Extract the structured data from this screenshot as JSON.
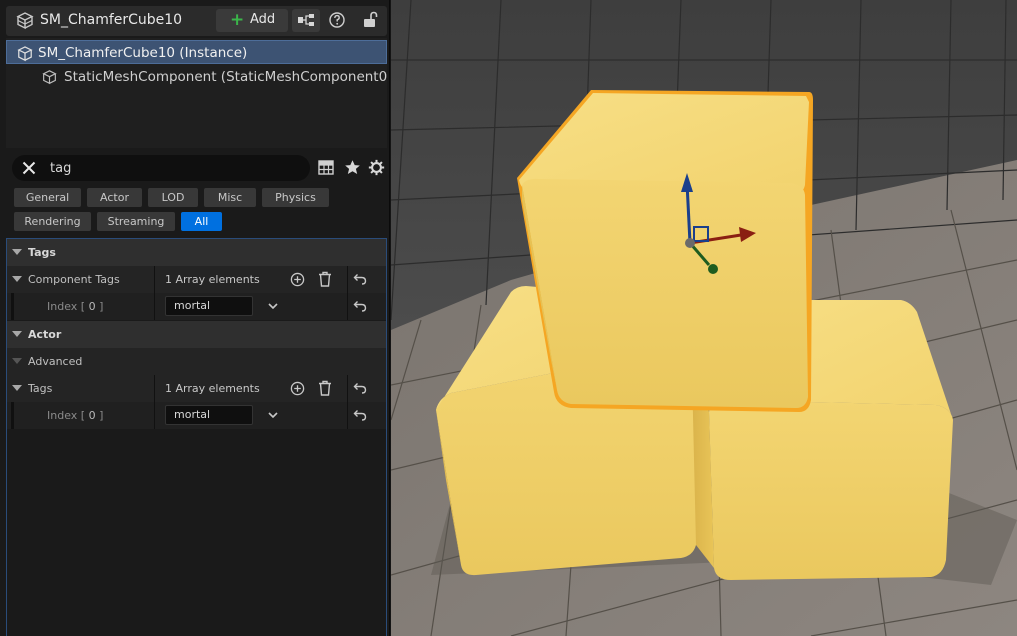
{
  "header": {
    "actor_name": "SM_ChamferCube10",
    "add_label": "Add"
  },
  "tree": {
    "items": [
      {
        "label": "SM_ChamferCube10 (Instance)",
        "selected": true
      },
      {
        "label": "StaticMeshComponent (StaticMeshComponent0)",
        "selected": false
      }
    ]
  },
  "search": {
    "value": "tag"
  },
  "filters": {
    "row1": [
      "General",
      "Actor",
      "LOD",
      "Misc",
      "Physics"
    ],
    "row2": [
      "Rendering",
      "Streaming",
      "All"
    ],
    "active": "All"
  },
  "details": {
    "tags_category": "Tags",
    "component_tags_label": "Component Tags",
    "component_tags_count": "1 Array elements",
    "index_word": "Index",
    "index_value": "0",
    "component_tag_value": "mortal",
    "actor_category": "Actor",
    "advanced_label": "Advanced",
    "actor_tags_label": "Tags",
    "actor_tags_count": "1 Array elements",
    "actor_tag_value": "mortal"
  },
  "colors": {
    "accent_blue": "#0070e0",
    "selection": "#3d5373",
    "cube_yellow": "#f2d06b",
    "selection_outline": "#f5a623"
  },
  "icons": [
    "actor-icon",
    "plus-icon",
    "blueprint-icon",
    "help-icon",
    "lock-icon",
    "mesh-icon",
    "close-icon",
    "table-icon",
    "star-icon",
    "gear-icon",
    "add-element-icon",
    "trash-icon",
    "reset-icon",
    "chevron-down-icon",
    "translate-gizmo"
  ]
}
